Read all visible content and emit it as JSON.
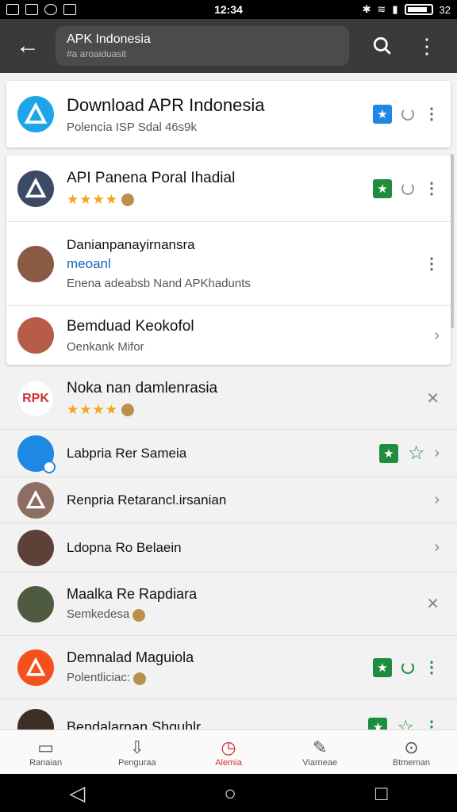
{
  "statusbar": {
    "time": "12:34",
    "battery": "32"
  },
  "appbar": {
    "query": "APK Indonesia",
    "subquery": "#a aroaiduasit"
  },
  "top_card": {
    "title": "Download APR Indonesia",
    "subtitle": "Polencia ISP Sdal 46s9k",
    "star": "★"
  },
  "card2": [
    {
      "title": "API Panena Poral Ihadial",
      "stars": "★★★★",
      "star": "★"
    },
    {
      "title": "Danianpanayirnansra",
      "link": "meoanl",
      "subtitle": "Enena adeabsb Nand APKhadunts"
    },
    {
      "title": "Bemduad Keokofol",
      "subtitle": "Oenkank Mifor"
    }
  ],
  "list": [
    {
      "title": "Noka nan damlenrasia",
      "stars": "★★★★",
      "logo": "RPK"
    },
    {
      "title": "Labpria Rer Sameia",
      "star": "★",
      "star_outline": "☆"
    },
    {
      "title": "Renpria Retarancl.irsanian"
    },
    {
      "title": "Ldopna Ro Belaein"
    },
    {
      "title": "Maalka Re Rapdiara",
      "subtitle": "Semkedesa"
    },
    {
      "title": "Demnalad Maguiola",
      "subtitle": "Polentliciac:",
      "star": "★"
    },
    {
      "title": "Bendalarnan Shguhlr",
      "star": "★",
      "star_outline": "☆"
    }
  ],
  "bottomnav": [
    {
      "label": "Ranaian"
    },
    {
      "label": "Penguraa"
    },
    {
      "label": "Alemia"
    },
    {
      "label": "Viarneae"
    },
    {
      "label": "Btmeman"
    }
  ],
  "colors": {
    "accent": "#d32f2f",
    "green": "#1e8e3e",
    "blue": "#1e88e5",
    "appbar": "#3a3a3a"
  }
}
